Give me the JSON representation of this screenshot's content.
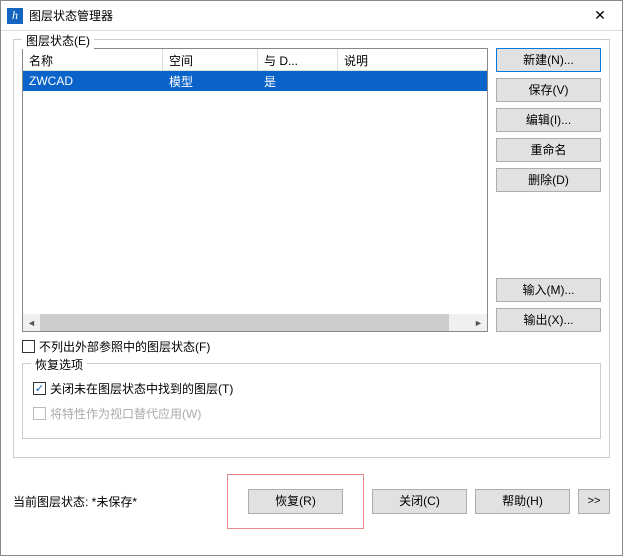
{
  "window": {
    "title": "图层状态管理器"
  },
  "group": {
    "legend": "图层状态(E)"
  },
  "table": {
    "headers": {
      "name": "名称",
      "space": "空间",
      "with_d": "与 D...",
      "desc": "说明"
    },
    "rows": [
      {
        "name": "ZWCAD",
        "space": "模型",
        "with_d": "是",
        "desc": ""
      }
    ]
  },
  "buttons": {
    "new": "新建(N)...",
    "save": "保存(V)",
    "edit": "编辑(I)...",
    "rename": "重命名",
    "delete": "删除(D)",
    "import": "输入(M)...",
    "export": "输出(X)..."
  },
  "checkbox_no_xref": "不列出外部参照中的图层状态(F)",
  "restore_group": {
    "legend": "恢复选项",
    "close_missing": "关闭未在图层状态中找到的图层(T)",
    "vp_override": "将特性作为视口替代应用(W)"
  },
  "status": {
    "label": "当前图层状态: ",
    "value": "*未保存*"
  },
  "bottom": {
    "restore": "恢复(R)",
    "close": "关闭(C)",
    "help": "帮助(H)",
    "expand": ">>"
  }
}
